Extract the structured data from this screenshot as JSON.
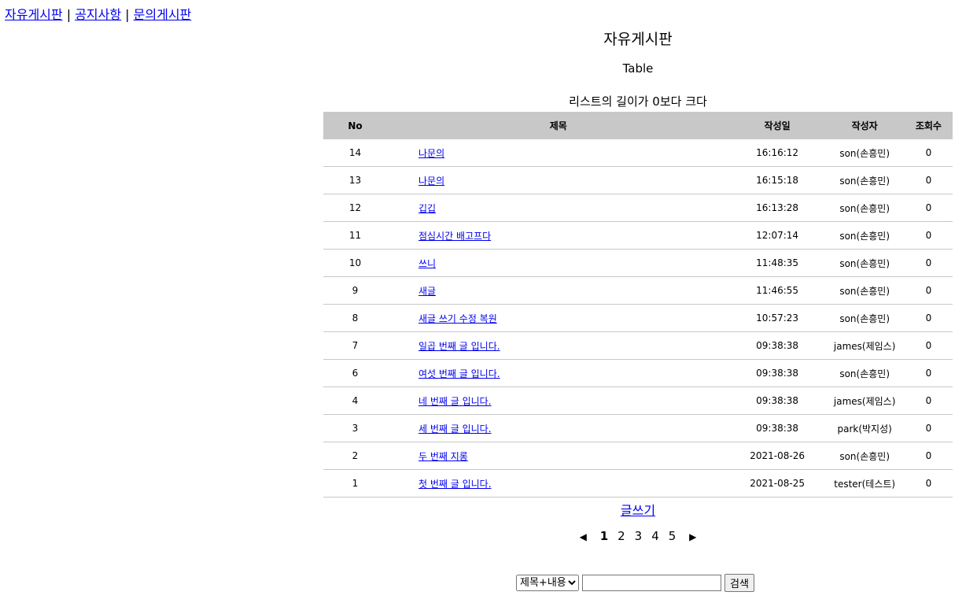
{
  "nav": {
    "items": [
      "자유게시판",
      "공지사항",
      "문의게시판"
    ],
    "separator": "|"
  },
  "board": {
    "title": "자유게시판",
    "subtitle": "Table",
    "note": "리스트의 길이가 0보다 크다",
    "columns": [
      "No",
      "제목",
      "작성일",
      "작성자",
      "조회수"
    ],
    "rows": [
      {
        "no": "14",
        "title": "나문의",
        "date": "16:16:12",
        "writer": "son(손흥민)",
        "hits": "0"
      },
      {
        "no": "13",
        "title": "나문의",
        "date": "16:15:18",
        "writer": "son(손흥민)",
        "hits": "0"
      },
      {
        "no": "12",
        "title": "깁깁",
        "date": "16:13:28",
        "writer": "son(손흥민)",
        "hits": "0"
      },
      {
        "no": "11",
        "title": "점심시간 배고프다",
        "date": "12:07:14",
        "writer": "son(손흥민)",
        "hits": "0"
      },
      {
        "no": "10",
        "title": "쓰니",
        "date": "11:48:35",
        "writer": "son(손흥민)",
        "hits": "0"
      },
      {
        "no": "9",
        "title": "새글",
        "date": "11:46:55",
        "writer": "son(손흥민)",
        "hits": "0"
      },
      {
        "no": "8",
        "title": "새글 쓰기 수정 복원",
        "date": "10:57:23",
        "writer": "son(손흥민)",
        "hits": "0"
      },
      {
        "no": "7",
        "title": "일곱 번째 글 입니다.",
        "date": "09:38:38",
        "writer": "james(제임스)",
        "hits": "0"
      },
      {
        "no": "6",
        "title": "여섯 번째 글 입니다.",
        "date": "09:38:38",
        "writer": "son(손흥민)",
        "hits": "0"
      },
      {
        "no": "4",
        "title": "네 번째 글 입니다.",
        "date": "09:38:38",
        "writer": "james(제임스)",
        "hits": "0"
      },
      {
        "no": "3",
        "title": "세 번째 글 입니다.",
        "date": "09:38:38",
        "writer": "park(박지성)",
        "hits": "0"
      },
      {
        "no": "2",
        "title": "두 번째 지롱",
        "date": "2021-08-26",
        "writer": "son(손흥민)",
        "hits": "0"
      },
      {
        "no": "1",
        "title": "첫 번째 글 입니다.",
        "date": "2021-08-25",
        "writer": "tester(테스트)",
        "hits": "0"
      }
    ],
    "write_label": "글쓰기"
  },
  "pager": {
    "prev": "◀",
    "pages": [
      "1",
      "2",
      "3",
      "4",
      "5"
    ],
    "current": "1",
    "next": "▶"
  },
  "search": {
    "selected_option": "제목+내용",
    "input_value": "",
    "button_label": "검색"
  },
  "colors": {
    "link": "#0000ee",
    "header_bg": "#c8c8c8",
    "row_border": "#c8c8c8"
  }
}
